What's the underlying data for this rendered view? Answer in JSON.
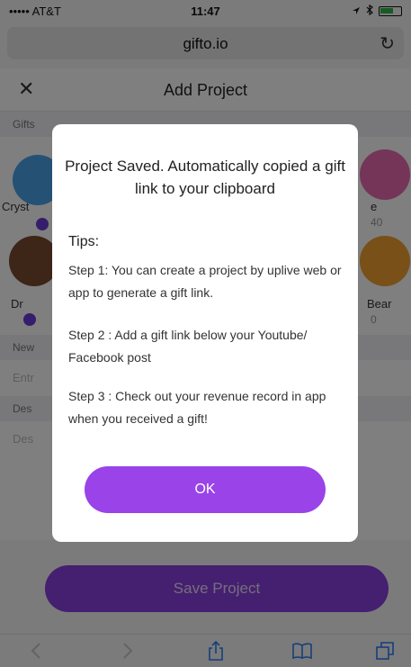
{
  "status_bar": {
    "carrier": "••••• AT&T",
    "time": "11:47"
  },
  "browser": {
    "url": "gifto.io",
    "reload_icon": "reload-icon"
  },
  "navbar": {
    "title": "Add Project",
    "close_icon": "close-icon"
  },
  "gifts_section": {
    "label": "Gifts",
    "visible_fragments": [
      {
        "name": "Cryst",
        "sub": ""
      },
      {
        "name": "e",
        "sub": "40"
      },
      {
        "name": "Dr",
        "sub": ""
      },
      {
        "name": "Bear",
        "sub": "0"
      }
    ]
  },
  "form": {
    "name_label": "New",
    "name_placeholder": "Entr",
    "description_label": "Des",
    "description_placeholder": "Des"
  },
  "save_button": {
    "label": "Save Project",
    "color": "#8a3fe0"
  },
  "modal": {
    "headline": "Project Saved. Automatically copied a gift link to your clipboard",
    "tips_title": "Tips:",
    "steps": [
      "Step 1: You can create a project by uplive web or app to generate a gift link.",
      "Step 2 : Add a gift link below your Youtube/ Facebook post",
      "Step 3 : Check out your revenue record in app when you received a gift!"
    ],
    "ok_label": "OK",
    "ok_color": "#9a43e8"
  },
  "toolbar": {
    "icons": [
      "back-icon",
      "forward-icon",
      "share-icon",
      "bookmarks-icon",
      "tabs-icon"
    ]
  }
}
